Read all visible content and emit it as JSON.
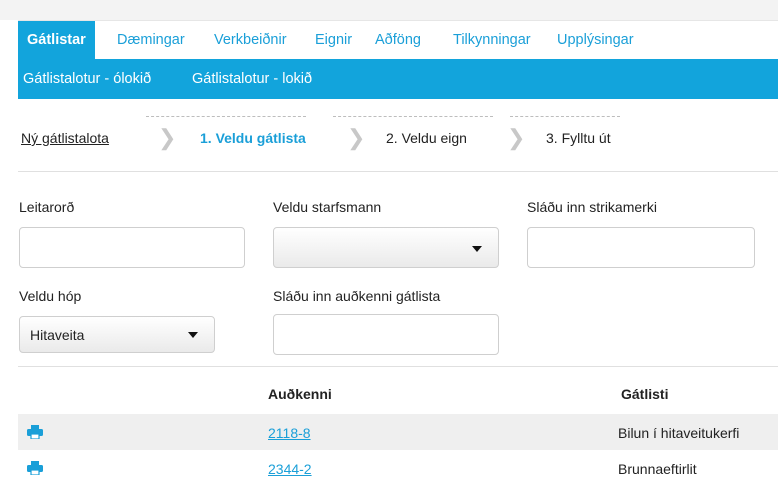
{
  "nav": {
    "tabs": [
      {
        "label": "Gátlistar",
        "active": true
      },
      {
        "label": "Dæmingar"
      },
      {
        "label": "Verkbeiðnir"
      },
      {
        "label": "Eignir"
      },
      {
        "label": "Aðföng"
      },
      {
        "label": "Tilkynningar"
      },
      {
        "label": "Upplýsingar"
      }
    ],
    "subtabs": [
      {
        "label": "Gátlistalotur - ólokið"
      },
      {
        "label": "Gátlistalotur - lokið"
      }
    ]
  },
  "wizard": {
    "new_link": "Ný gátlistalota",
    "steps": [
      {
        "label": "1. Veldu gátlista",
        "active": true
      },
      {
        "label": "2. Veldu eign"
      },
      {
        "label": "3. Fylltu út"
      }
    ]
  },
  "filters": {
    "search_label": "Leitarorð",
    "search_value": "",
    "employee_label": "Veldu starfsmann",
    "employee_value": "",
    "barcode_label": "Sláðu inn strikamerki",
    "barcode_value": "",
    "group_label": "Veldu hóp",
    "group_value": "Hitaveita",
    "checklist_id_label": "Sláðu inn auðkenni gátlista",
    "checklist_id_value": ""
  },
  "table": {
    "columns": [
      "",
      "Auðkenni",
      "Gátlisti"
    ],
    "rows": [
      {
        "id": "2118-8",
        "name": "Bilun í hitaveitukerfi",
        "icon": "print-icon"
      },
      {
        "id": "2344-2",
        "name": "Brunnaeftirlit",
        "icon": "print-icon"
      }
    ]
  },
  "colors": {
    "accent": "#12a4dc",
    "link": "#1a9fd8",
    "row_shade": "#efefef"
  }
}
